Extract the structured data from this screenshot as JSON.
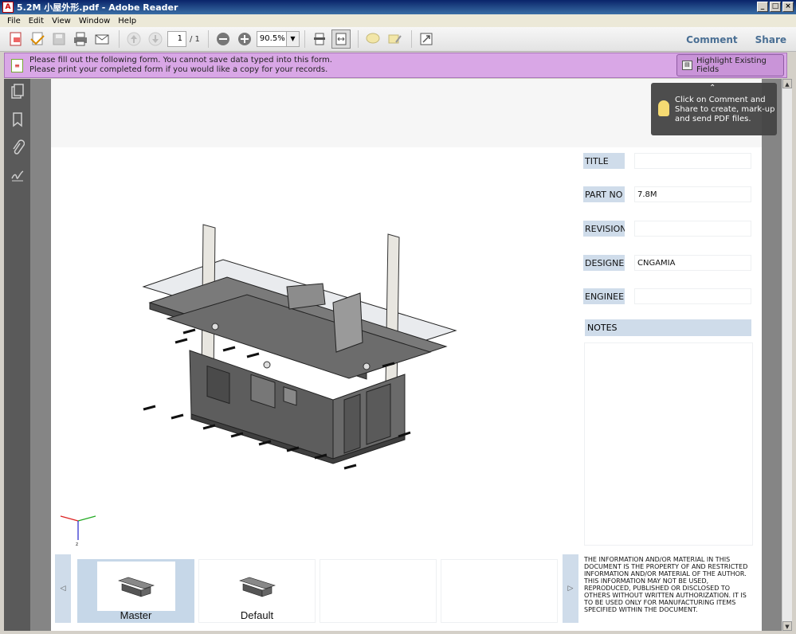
{
  "window": {
    "title": "5.2M 小屋外形.pdf - Adobe Reader",
    "app_icon": "pdf-icon",
    "buttons": [
      "_",
      "□",
      "×"
    ]
  },
  "menubar": [
    "File",
    "Edit",
    "View",
    "Window",
    "Help"
  ],
  "toolbar": {
    "page_current": "1",
    "page_total": "/ 1",
    "zoom": "90.5%",
    "comment_label": "Comment",
    "share_label": "Share"
  },
  "formbar": {
    "message_line1": "Please fill out the following form. You cannot save data typed into this form.",
    "message_line2": "Please print your completed form if you would like a copy for your records.",
    "highlight_label": "Highlight Existing Fields"
  },
  "tooltip": {
    "text_line1": "Click on Comment and",
    "text_line2": "Share to create, mark-up",
    "text_line3": "and send PDF files."
  },
  "titleblock": {
    "fields": [
      {
        "label": "TITLE",
        "value": ""
      },
      {
        "label": "PART NO",
        "value": "7.8M"
      },
      {
        "label": "REVISION",
        "value": ""
      },
      {
        "label": "DESIGNER",
        "value": "CNGAMIA"
      },
      {
        "label": "ENGINEER",
        "value": ""
      }
    ],
    "notes_label": "NOTES",
    "disclaimer": "THE INFORMATION AND/OR MATERIAL IN THIS DOCUMENT IS THE PROPERTY OF AND RESTRICTED INFORMATION AND/OR MATERIAL OF THE AUTHOR. THIS INFORMATION MAY NOT BE USED, REPRODUCED, PUBLISHED OR DISCLOSED TO OTHERS WITHOUT WRITTEN AUTHORIZATION. IT IS TO BE USED ONLY FOR MANUFACTURING ITEMS SPECIFIED WITHIN THE DOCUMENT."
  },
  "views": [
    {
      "label": "Master",
      "active": true
    },
    {
      "label": "Default",
      "active": false
    },
    {
      "label": "",
      "active": false
    },
    {
      "label": "",
      "active": false
    }
  ],
  "colors": {
    "formbar": "#d9a7e6",
    "field_label_bg": "#cfdcea",
    "accent_link": "#4a6f94"
  }
}
